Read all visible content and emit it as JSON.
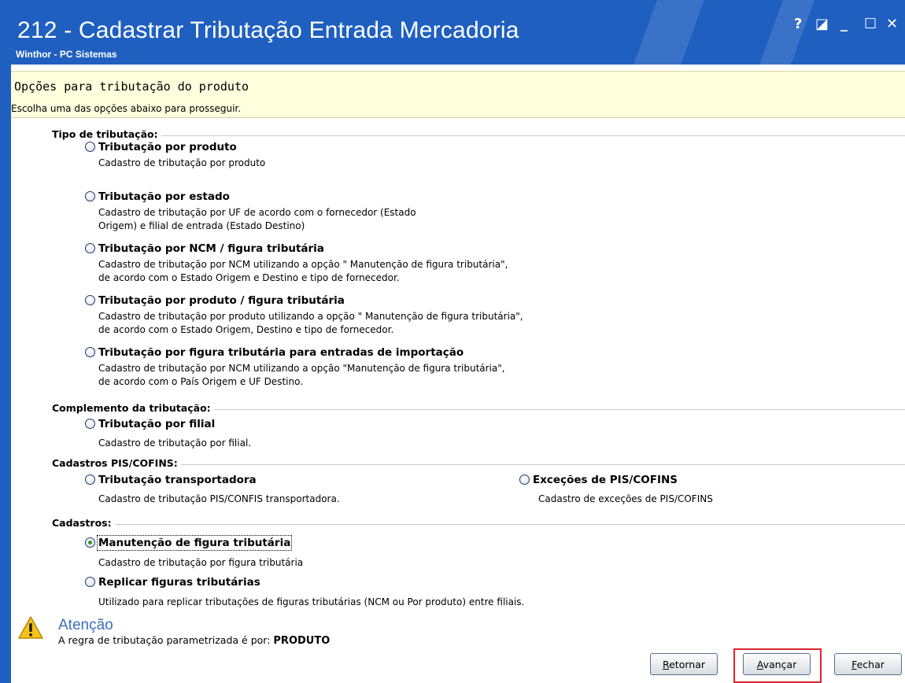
{
  "window": {
    "title": "212 - Cadastrar Tributação Entrada Mercadoria",
    "subtitle": "Winthor - PC Sistemas",
    "controls": {
      "help": "?",
      "restore": "◪",
      "minimize": "_",
      "maximize": "☐",
      "close": "✕"
    }
  },
  "banner": {
    "heading": "Opções para tributação do produto",
    "subheading": "Escolha uma das opções abaixo para prosseguir."
  },
  "groups": {
    "tipo": {
      "title": "Tipo de tributação:",
      "options": [
        {
          "label": "Tributação por produto",
          "desc": "Cadastro de tributação por produto",
          "checked": false
        },
        {
          "label": "Tributação por estado",
          "desc": "Cadastro de tributação por UF de acordo com o fornecedor (Estado\nOrigem) e filial de entrada (Estado Destino)",
          "checked": false
        },
        {
          "label": "Tributação por NCM / figura tributária",
          "desc": "Cadastro de tributação por NCM utilizando a opção \" Manutenção de figura tributária\",\nde acordo com o Estado Origem e Destino e tipo de fornecedor.",
          "checked": false
        },
        {
          "label": "Tributação por produto / figura tributária",
          "desc": "Cadastro de tributação por produto utilizando a opção \" Manutenção de figura tributária\",\nde acordo com o Estado Origem, Destino e tipo de fornecedor.",
          "checked": false
        },
        {
          "label": "Tributação por figura tributária para entradas de importação",
          "desc": "Cadastro de tributação por NCM utilizando a opção \"Manutenção de figura tributária\",\nde acordo com o País Origem e UF Destino.",
          "checked": false
        }
      ]
    },
    "complemento": {
      "title": "Complemento da tributação:",
      "options": [
        {
          "label": "Tributação por filial",
          "desc": "Cadastro de tributação por filial.",
          "checked": false
        }
      ]
    },
    "pis": {
      "title": "Cadastros PIS/COFINS:",
      "options": [
        {
          "label": "Tributação  transportadora",
          "desc": "Cadastro de tributação PIS/CONFIS transportadora.",
          "checked": false
        },
        {
          "label": "Exceções de PIS/COFINS",
          "desc": "Cadastro de exceções de PIS/COFINS",
          "checked": false
        }
      ]
    },
    "cadastros": {
      "title": "Cadastros:",
      "options": [
        {
          "label": "Manutenção de figura tributária",
          "desc": "Cadastro de tributação por figura tributária",
          "checked": true
        },
        {
          "label": "Replicar figuras tributárias",
          "desc": "Utilizado para replicar tributações de figuras tributárias (NCM ou Por produto) entre filiais.",
          "checked": false
        }
      ]
    }
  },
  "attention": {
    "title": "Atenção",
    "message": "A regra de tributação parametrizada é por:",
    "value": "PRODUTO"
  },
  "buttons": {
    "retornar": {
      "accel": "R",
      "rest": "etornar"
    },
    "avancar": {
      "accel": "A",
      "rest": "vançar"
    },
    "fechar": {
      "accel": "F",
      "rest": "echar"
    }
  },
  "colors": {
    "titlebar": "#1f5fc0",
    "banner": "#fffedd",
    "attention": "#3b6fbe",
    "highlight": "#d9262c"
  }
}
